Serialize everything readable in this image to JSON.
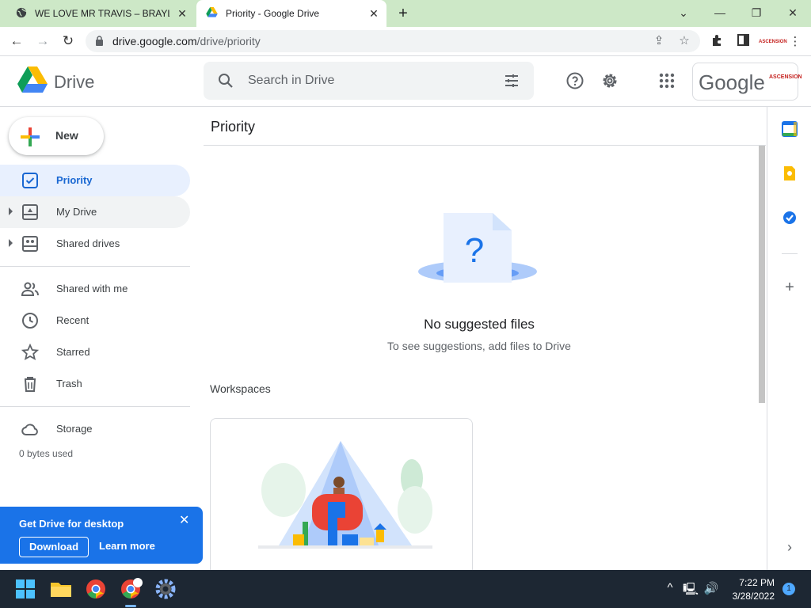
{
  "browser": {
    "tabs": [
      {
        "title": "WE LOVE MR TRAVIS – BRAYLIN.C",
        "icon": "globe-icon",
        "active": false
      },
      {
        "title": "Priority - Google Drive",
        "icon": "drive-icon",
        "active": true
      }
    ],
    "url_domain": "drive.google.com",
    "url_path": "/drive/priority"
  },
  "drive": {
    "app_name": "Drive",
    "search_placeholder": "Search in Drive",
    "account_word": "Google",
    "account_badge": "ASCENSION"
  },
  "sidebar": {
    "new_label": "New",
    "items": [
      {
        "label": "Priority",
        "icon": "priority-check-icon",
        "active": true
      },
      {
        "label": "My Drive",
        "icon": "my-drive-icon",
        "expandable": true
      },
      {
        "label": "Shared drives",
        "icon": "shared-drives-icon",
        "expandable": true
      },
      {
        "label": "Shared with me",
        "icon": "people-icon"
      },
      {
        "label": "Recent",
        "icon": "clock-icon"
      },
      {
        "label": "Starred",
        "icon": "star-icon"
      },
      {
        "label": "Trash",
        "icon": "trash-icon"
      },
      {
        "label": "Storage",
        "icon": "cloud-icon"
      }
    ],
    "storage_used": "0 bytes used"
  },
  "promo": {
    "title": "Get Drive for desktop",
    "download_label": "Download",
    "learn_more_label": "Learn more"
  },
  "main": {
    "page_title": "Priority",
    "empty_title": "No suggested files",
    "empty_subtitle": "To see suggestions, add files to Drive",
    "workspaces_label": "Workspaces"
  },
  "side_panel": {
    "calendar_day": "31",
    "icons": [
      "calendar-icon",
      "keep-icon",
      "tasks-icon",
      "add-icon",
      "expand-panel-icon"
    ]
  },
  "taskbar": {
    "time": "7:22 PM",
    "date": "3/28/2022",
    "notification_count": "1"
  },
  "colors": {
    "accent": "#1a73e8",
    "active_nav_bg": "#e8f0fe",
    "active_nav_text": "#1967d2",
    "tab_strip": "#cde8c7",
    "taskbar": "#1d2733"
  }
}
